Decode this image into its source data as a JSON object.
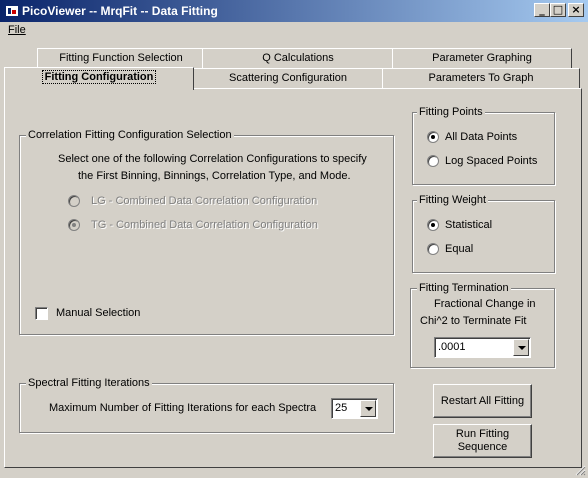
{
  "window": {
    "title": "PicoViewer -- MrqFit -- Data Fitting",
    "minimize_glyph": "_",
    "maximize_glyph": "□",
    "close_glyph": "×"
  },
  "menu": {
    "file_label": "File"
  },
  "tabs": {
    "back_row": [
      "Fitting Function Selection",
      "Q  Calculations",
      "Parameter Graphing"
    ],
    "front_row": [
      "Fitting Configuration",
      "Scattering Configuration",
      "Parameters To Graph"
    ],
    "active": "Fitting Configuration"
  },
  "correlation": {
    "group_label": "Correlation Fitting Configuration Selection",
    "instruction_line1": "Select one of the following Correlation Configurations to specify",
    "instruction_line2": "the First Binning, Binnings, Correlation Type, and Mode.",
    "option_lg": "LG - Combined Data Correlation Configuration",
    "option_tg": "TG - Combined Data Correlation Configuration",
    "selected": "TG",
    "manual_selection_label": "Manual Selection",
    "manual_selection_checked": false
  },
  "fitting_points": {
    "group_label": "Fitting Points",
    "option_all": "All Data Points",
    "option_log": "Log Spaced Points",
    "selected": "All Data Points"
  },
  "fitting_weight": {
    "group_label": "Fitting Weight",
    "option_statistical": "Statistical",
    "option_equal": "Equal",
    "selected": "Statistical"
  },
  "fitting_termination": {
    "group_label": "Fitting Termination",
    "desc_line1": "Fractional Change in",
    "desc_line2": "Chi^2 to Terminate Fit",
    "value": ".0001"
  },
  "spectral": {
    "group_label": "Spectral Fitting Iterations",
    "max_iter_label": "Maximum Number of Fitting Iterations for each Spectra",
    "value": "25"
  },
  "buttons": {
    "restart_all": "Restart All Fitting",
    "run_line1": "Run Fitting",
    "run_line2": "Sequence"
  }
}
